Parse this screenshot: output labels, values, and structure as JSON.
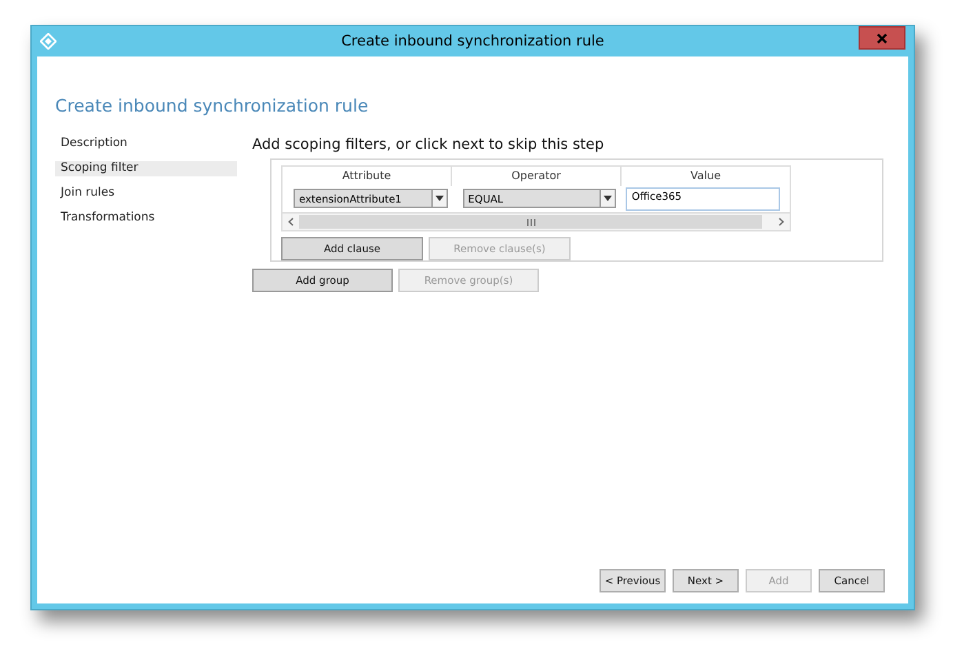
{
  "window": {
    "title": "Create inbound synchronization rule"
  },
  "heading": "Create inbound synchronization rule",
  "sidebar": {
    "items": [
      {
        "label": "Description",
        "selected": false
      },
      {
        "label": "Scoping filter",
        "selected": true
      },
      {
        "label": "Join rules",
        "selected": false
      },
      {
        "label": "Transformations",
        "selected": false
      }
    ]
  },
  "step_title": "Add scoping filters, or click next to skip this step",
  "filter_table": {
    "columns": [
      "Attribute",
      "Operator",
      "Value"
    ],
    "rows": [
      {
        "attribute": "extensionAttribute1",
        "operator": "EQUAL",
        "value": "Office365"
      }
    ],
    "buttons": [
      {
        "label": "Add clause",
        "disabled": false
      },
      {
        "label": "Remove clause(s)",
        "disabled": true
      }
    ]
  },
  "group_buttons": [
    {
      "label": "Add group",
      "disabled": false
    },
    {
      "label": "Remove group(s)",
      "disabled": true
    }
  ],
  "footer_buttons": [
    {
      "label": "< Previous",
      "disabled": false
    },
    {
      "label": "Next >",
      "disabled": false
    },
    {
      "label": "Add",
      "disabled": true
    },
    {
      "label": "Cancel",
      "disabled": false
    }
  ]
}
